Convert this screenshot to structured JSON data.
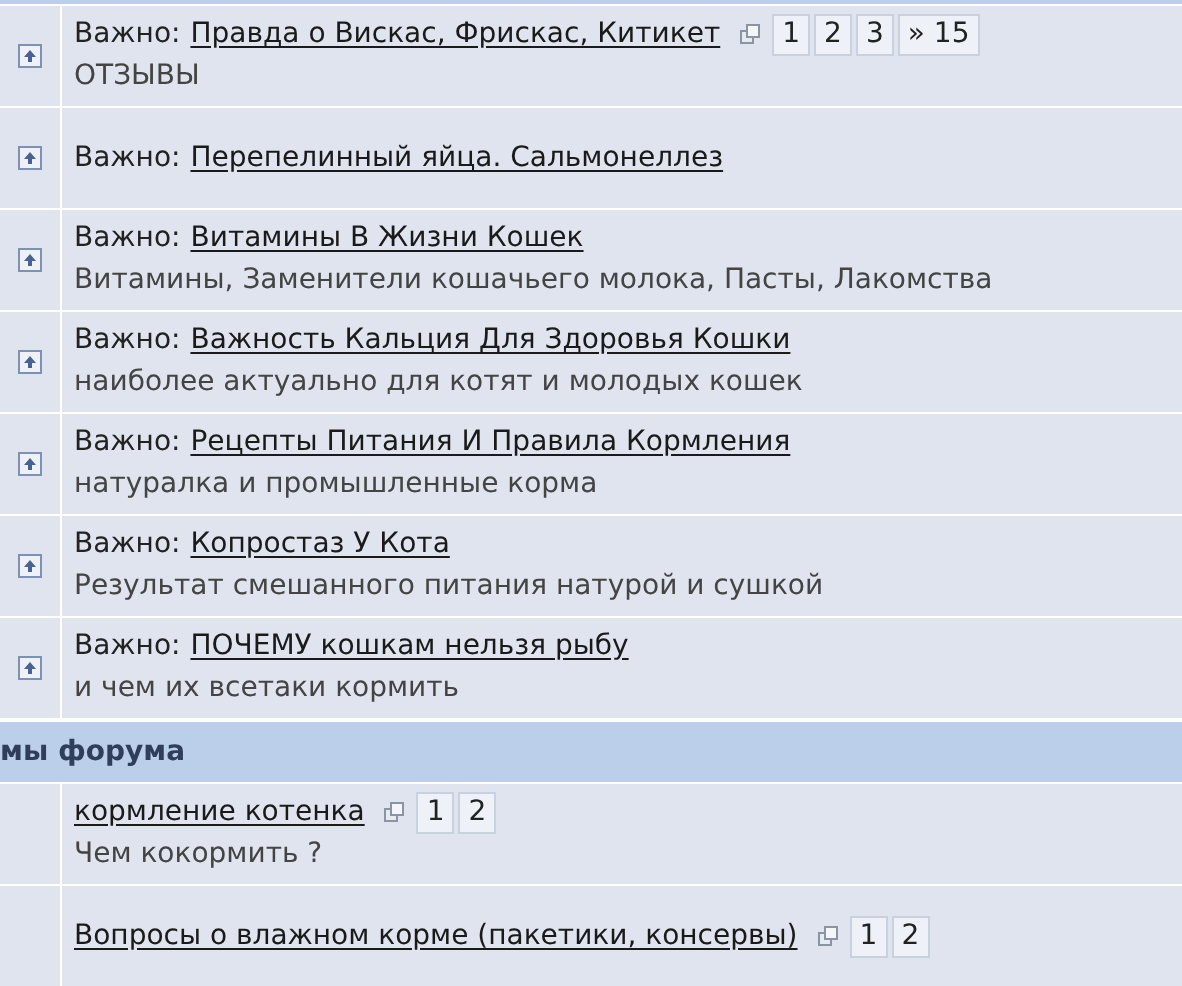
{
  "sticky_topics": [
    {
      "prefix": "Важно:",
      "title": "Правда о Вискас, Фрискас, Китикет",
      "pages": [
        "1",
        "2",
        "3",
        "» 15"
      ],
      "description": "ОТЗЫВЫ"
    },
    {
      "prefix": "Важно:",
      "title": "Перепелинный яйца. Сальмонеллез"
    },
    {
      "prefix": "Важно:",
      "title": "Витамины В Жизни Кошек",
      "description": "Витамины, Заменители кошачьего молока, Пасты, Лакомства"
    },
    {
      "prefix": "Важно:",
      "title": "Важность Кальция Для Здоровья Кошки",
      "description": "наиболее актуально для котят и молодых кошек"
    },
    {
      "prefix": "Важно:",
      "title": "Рецепты Питания И Правила Кормления",
      "description": "натуралка и промышленные корма"
    },
    {
      "prefix": "Важно:",
      "title": "Копростаз У Кота",
      "description": "Результат смешанного питания натурой и сушкой"
    },
    {
      "prefix": "Важно:",
      "title": "ПОЧЕМУ кошкам нельзя рыбу",
      "description": "и чем их всетаки кормить"
    }
  ],
  "section_header": "мы форума",
  "topics": [
    {
      "title": "кормление котенка",
      "pages": [
        "1",
        "2"
      ],
      "description": "Чем кокормить ?"
    },
    {
      "title": "Вопросы о влажном корме (пакетики, консервы)",
      "pages": [
        "1",
        "2"
      ]
    }
  ]
}
